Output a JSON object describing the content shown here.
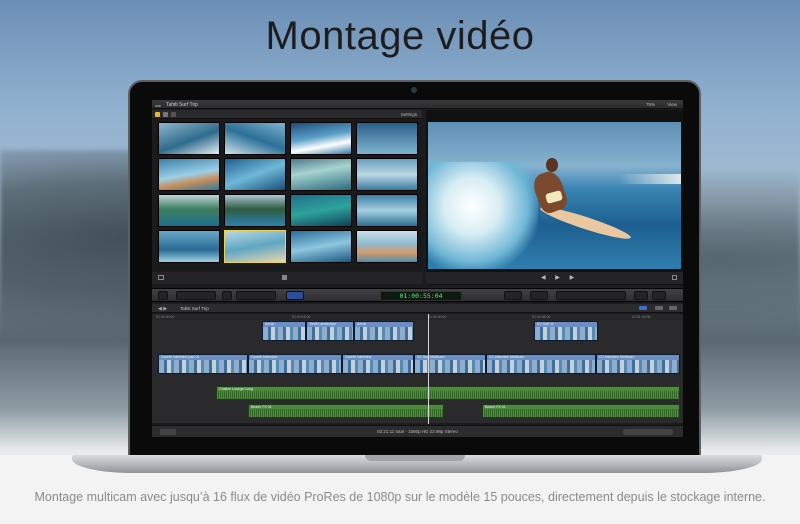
{
  "headline": "Montage vidéo",
  "caption": "Montage multicam avec jusqu’à 16 flux de vidéo ProRes de 1080p sur le modèle 15 pouces, directement depuis le stockage interne.",
  "app": {
    "window_title": "Tahiti Surf Trip",
    "zoom": "75%",
    "view_menu": "View",
    "settings_menu": "Settings",
    "timecode": "01:00:55:04",
    "project_name": "Tahiti Surf Trip",
    "status_text": "02:21:11 total - 1080p HD 23.98p Stereo",
    "ruler_marks": [
      "01:00:00:00",
      "01:00:15:00",
      "01:00:30:00",
      "01:00:45:00",
      "01:01:00:00"
    ]
  },
  "timeline": {
    "connected_clips": [
      "Aerial",
      "Tahiti Landscape",
      "Aerial",
      "GJ Surf 11"
    ],
    "primary_clips": [
      "Gareth Interview part 01",
      "Gareth Interview",
      "Gareth Interview",
      "GJ Surf Multicam",
      "GJ Interview Multicam",
      "GJ Interview Multicam"
    ],
    "audio_clips": [
      "Chalice Lounge Long",
      "Beach FX 01",
      "Beach FX 01"
    ]
  },
  "colors": {
    "timecode_green": "#6fe07e",
    "selection_yellow": "#e9d44c",
    "clip_blue": "#4a6fa8",
    "audio_green": "#356c2a"
  }
}
